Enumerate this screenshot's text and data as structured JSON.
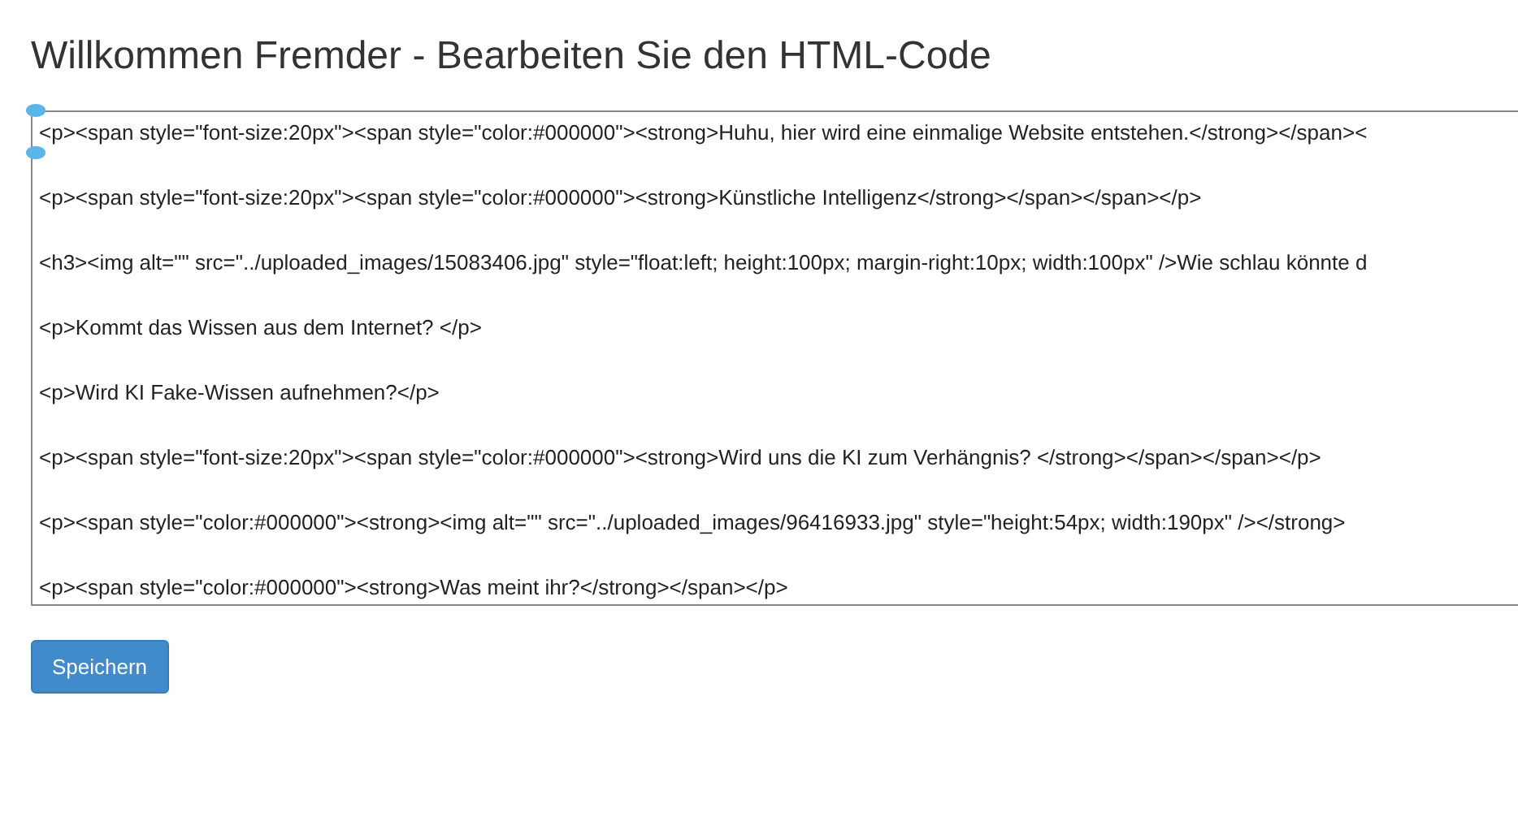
{
  "heading": "Willkommen Fremder - Bearbeiten Sie den HTML-Code",
  "editor": {
    "lines": [
      "<p><span style=\"font-size:20px\"><span style=\"color:#000000\"><strong>Huhu, hier wird eine einmalige Website entstehen.</strong></span><",
      "<p><span style=\"font-size:20px\"><span style=\"color:#000000\"><strong>Künstliche Intelligenz</strong></span></span></p>",
      "<h3><img alt=\"\" src=\"../uploaded_images/15083406.jpg\" style=\"float:left; height:100px; margin-right:10px; width:100px\" />Wie schlau könnte d",
      "<p>Kommt das Wissen aus dem Internet? </p>",
      "<p>Wird KI Fake-Wissen aufnehmen?</p>",
      "<p><span style=\"font-size:20px\"><span style=\"color:#000000\"><strong>Wird uns die KI zum Verhängnis? </strong></span></span></p>",
      "<p><span style=\"color:#000000\"><strong><img alt=\"\" src=\"../uploaded_images/96416933.jpg\" style=\"height:54px; width:190px\" /></strong>",
      "<p><span style=\"color:#000000\"><strong>Was meint ihr?</strong></span></p>"
    ]
  },
  "save_button": "Speichern"
}
